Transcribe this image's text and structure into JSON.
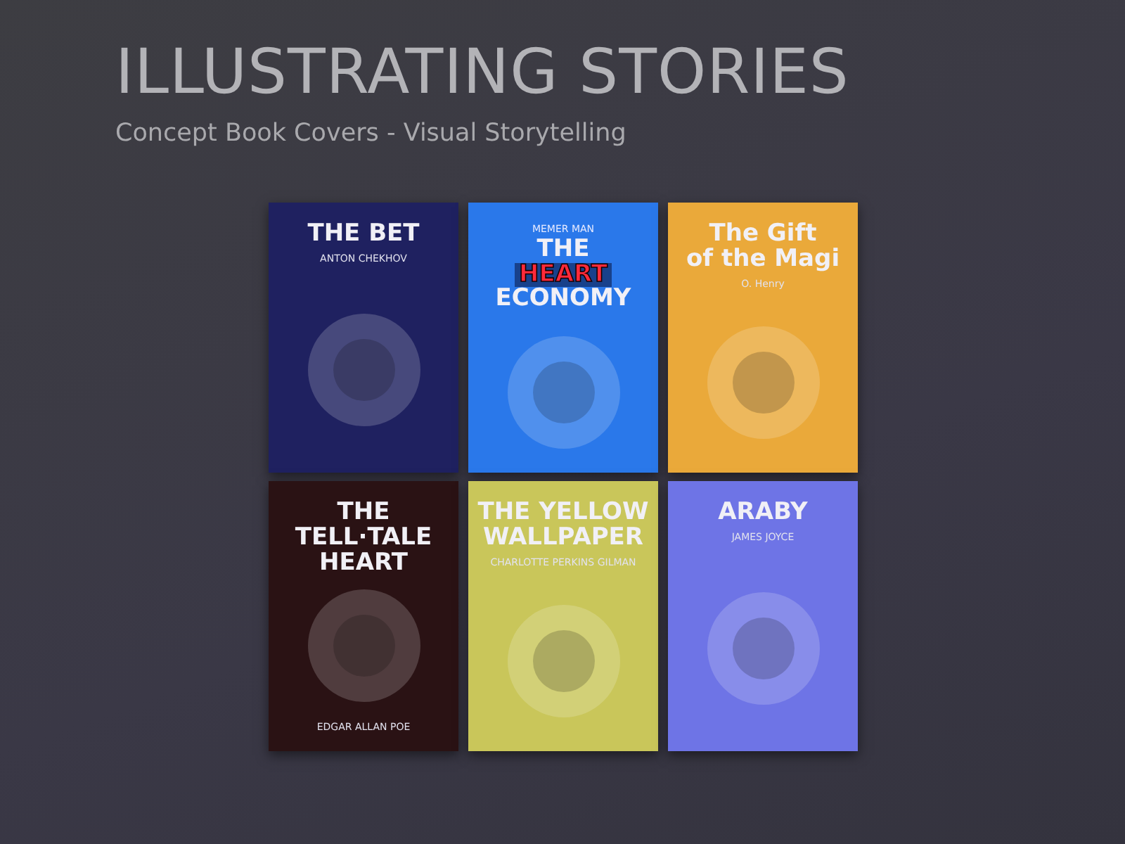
{
  "header": {
    "title": "ILLUSTRATING STORIES",
    "subtitle": "Concept Book Covers - Visual Storytelling"
  },
  "covers": [
    {
      "kind": "title-top",
      "color": "#1f2160",
      "title_lines": [
        {
          "text": "THE BET",
          "highlight": false
        }
      ],
      "author": "ANTON CHEKHOV"
    },
    {
      "kind": "title-top",
      "color": "#2a78ea",
      "publisher": "MEMER MAN",
      "title_lines": [
        {
          "text": "THE",
          "highlight": false
        },
        {
          "text": "HEART",
          "highlight": true
        },
        {
          "text": "ECONOMY",
          "highlight": false
        }
      ]
    },
    {
      "kind": "title-top",
      "color": "#eaa93a",
      "title_lines": [
        {
          "text": "The Gift",
          "highlight": false
        },
        {
          "text": "of the Magi",
          "highlight": false
        }
      ],
      "author": "O. Henry"
    },
    {
      "kind": "author-bottom",
      "color": "#2a1214",
      "title_lines": [
        {
          "text": "THE",
          "highlight": false
        },
        {
          "text": "TELL·TALE",
          "highlight": false
        },
        {
          "text": "HEART",
          "highlight": false
        }
      ],
      "author": "EDGAR ALLAN POE"
    },
    {
      "kind": "title-top",
      "color": "#c9c65a",
      "title_lines": [
        {
          "text": "THE YELLOW",
          "highlight": false
        },
        {
          "text": "WALLPAPER",
          "highlight": false
        }
      ],
      "author": "CHARLOTTE PERKINS GILMAN"
    },
    {
      "kind": "title-top",
      "color": "#6e74e6",
      "title_lines": [
        {
          "text": "ARABY",
          "highlight": false
        }
      ],
      "author": "JAMES JOYCE"
    }
  ]
}
